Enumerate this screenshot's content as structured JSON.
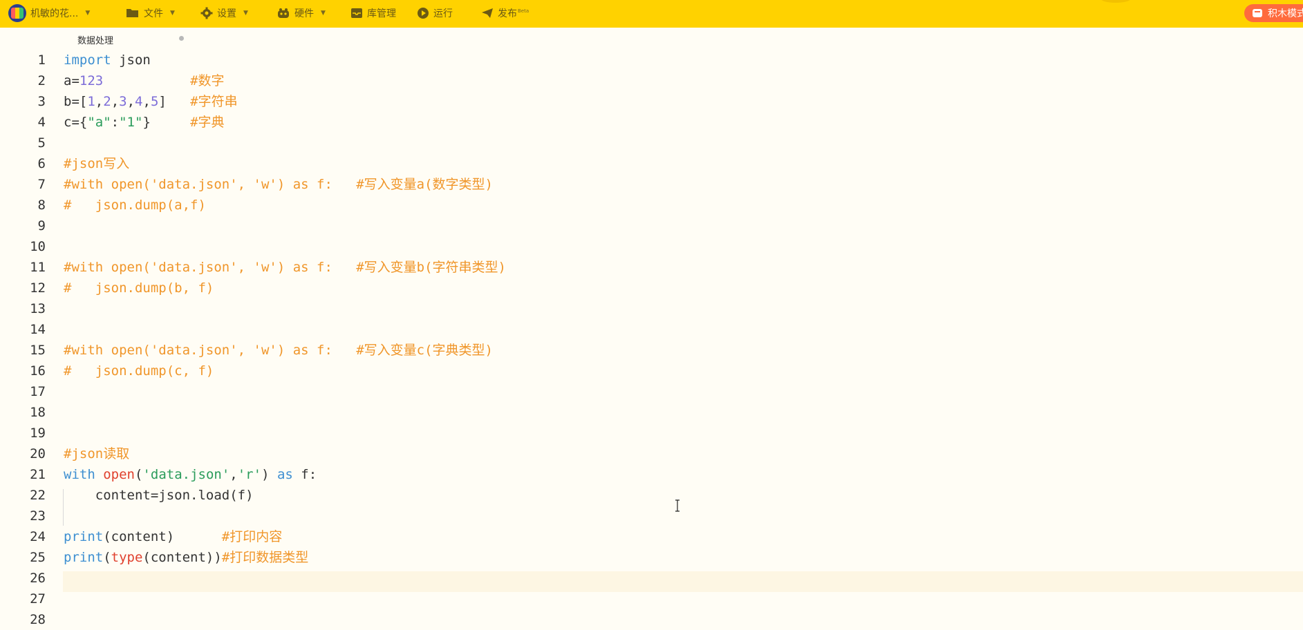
{
  "toolbar": {
    "project": "机敏的花...",
    "file": "文件",
    "settings": "设置",
    "hardware": "硬件",
    "library": "库管理",
    "run": "运行",
    "publish": "发布",
    "publish_badge": "Beta",
    "block_mode": "积木模式"
  },
  "tab": {
    "title": "数据处理"
  },
  "editor": {
    "lines": [
      [
        {
          "t": "import",
          "c": "kw"
        },
        {
          "t": " json"
        }
      ],
      [
        {
          "t": "a="
        },
        {
          "t": "123",
          "c": "num"
        },
        {
          "t": "           "
        },
        {
          "t": "#数字",
          "c": "cm"
        }
      ],
      [
        {
          "t": "b=["
        },
        {
          "t": "1",
          "c": "num"
        },
        {
          "t": ","
        },
        {
          "t": "2",
          "c": "num"
        },
        {
          "t": ","
        },
        {
          "t": "3",
          "c": "num"
        },
        {
          "t": ","
        },
        {
          "t": "4",
          "c": "num"
        },
        {
          "t": ","
        },
        {
          "t": "5",
          "c": "num"
        },
        {
          "t": "]   "
        },
        {
          "t": "#字符串",
          "c": "cm"
        }
      ],
      [
        {
          "t": "c={"
        },
        {
          "t": "\"a\"",
          "c": "str"
        },
        {
          "t": ":"
        },
        {
          "t": "\"1\"",
          "c": "str"
        },
        {
          "t": "}     "
        },
        {
          "t": "#字典",
          "c": "cm"
        }
      ],
      [],
      [
        {
          "t": "#json写入",
          "c": "cm"
        }
      ],
      [
        {
          "t": "#with open('data.json', 'w') as f:   #写入变量a(数字类型)",
          "c": "cm"
        }
      ],
      [
        {
          "t": "#   json.dump(a,f)",
          "c": "cm"
        }
      ],
      [],
      [],
      [
        {
          "t": "#with open('data.json', 'w') as f:   #写入变量b(字符串类型)",
          "c": "cm"
        }
      ],
      [
        {
          "t": "#   json.dump(b, f)",
          "c": "cm"
        }
      ],
      [],
      [],
      [
        {
          "t": "#with open('data.json', 'w') as f:   #写入变量c(字典类型)",
          "c": "cm"
        }
      ],
      [
        {
          "t": "#   json.dump(c, f)",
          "c": "cm"
        }
      ],
      [],
      [],
      [],
      [
        {
          "t": "#json读取",
          "c": "cm"
        }
      ],
      [
        {
          "t": "with",
          "c": "kw"
        },
        {
          "t": " "
        },
        {
          "t": "open",
          "c": "fn"
        },
        {
          "t": "("
        },
        {
          "t": "'data.json'",
          "c": "str"
        },
        {
          "t": ","
        },
        {
          "t": "'r'",
          "c": "str"
        },
        {
          "t": ") "
        },
        {
          "t": "as",
          "c": "kw"
        },
        {
          "t": " f:"
        }
      ],
      [
        {
          "t": "    content=json.load(f)"
        }
      ],
      [],
      [
        {
          "t": "print",
          "c": "kw"
        },
        {
          "t": "(content)      "
        },
        {
          "t": "#打印内容",
          "c": "cm"
        }
      ],
      [
        {
          "t": "print",
          "c": "kw"
        },
        {
          "t": "("
        },
        {
          "t": "type",
          "c": "fn"
        },
        {
          "t": "(content))"
        },
        {
          "t": "#打印数据类型",
          "c": "cm"
        }
      ],
      [],
      [],
      []
    ]
  }
}
